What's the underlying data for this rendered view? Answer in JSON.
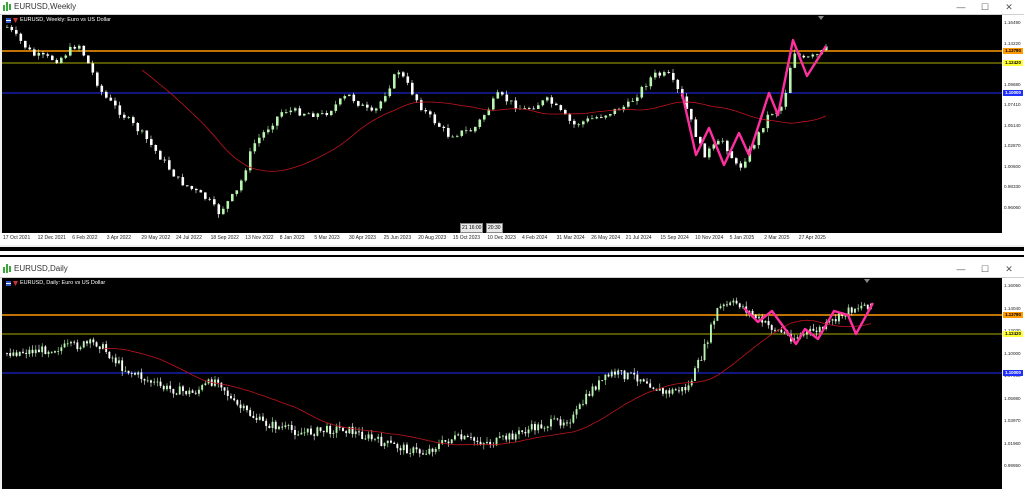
{
  "top": {
    "title": "EURUSD,Weekly",
    "chart_label": "EURUSD, Weekly:  Euro vs US Dollar",
    "window_buttons": [
      "—",
      "☐",
      "✕"
    ],
    "y_labels": [
      "1.16490",
      "1.14220",
      "1.11950",
      "1.09680",
      "1.07410",
      "1.05140",
      "1.02870",
      "1.00600",
      "0.98330",
      "0.96060"
    ],
    "price_tags": [
      {
        "text": "1.13780",
        "bg": "#ff9900"
      },
      {
        "text": "1.12420",
        "bg": "#ffff33"
      },
      {
        "text": "1.10000",
        "bg": "#1f2fff"
      }
    ],
    "x_labels": [
      "17 Oct 2021",
      "12 Dec 2021",
      "6 Feb 2022",
      "3 Apr 2022",
      "29 May 2022",
      "24 Jul 2022",
      "18 Sep 2022",
      "13 Nov 2022",
      "8 Jan 2023",
      "5 Mar 2023",
      "30 Apr 2023",
      "25 Jun 2023",
      "20 Aug 2023",
      "15 Oct 2023",
      "10 Dec 2023",
      "4 Feb 2024",
      "31 Mar 2024",
      "26 May 2024",
      "21 Jul 2024",
      "15 Sep 2024",
      "10 Nov 2024",
      "5 Jan 2025",
      "2 Mar 2025",
      "27 Apr 2025"
    ],
    "time_boxes": [
      "21 16:00",
      "20:30"
    ]
  },
  "bottom": {
    "title": "EURUSD,Daily",
    "chart_label": "EURUSD, Daily:  Euro vs US Dollar",
    "window_buttons": [
      "—",
      "☐",
      "✕"
    ],
    "y_labels": [
      "1.16050",
      "1.14040",
      "1.12030",
      "1.10000",
      "1.07990",
      "1.05980",
      "1.03970",
      "1.01960",
      "0.99950"
    ],
    "price_tags": [
      {
        "text": "1.13780",
        "bg": "#ff9900"
      },
      {
        "text": "1.12420",
        "bg": "#ffff33"
      },
      {
        "text": "1.10000",
        "bg": "#1f2fff"
      }
    ]
  },
  "colors": {
    "bull": "#b8f5b0",
    "bear": "#ffffff",
    "ma": "#c0141c",
    "pattern": "#ff2fa0",
    "resistance": "#ff9900",
    "support": "#e6e600",
    "level": "#1f2fff"
  }
}
